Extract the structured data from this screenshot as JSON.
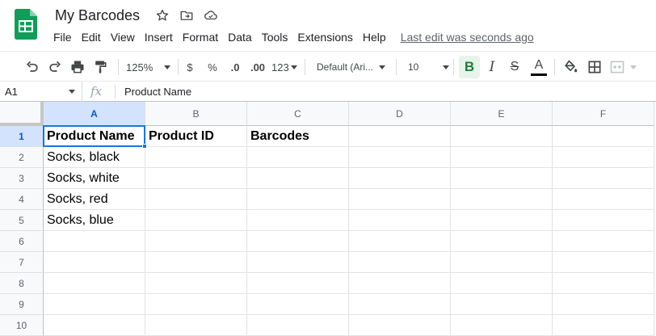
{
  "doc": {
    "title": "My Barcodes",
    "last_edit": "Last edit was seconds ago"
  },
  "menu": [
    "File",
    "Edit",
    "View",
    "Insert",
    "Format",
    "Data",
    "Tools",
    "Extensions",
    "Help"
  ],
  "toolbar": {
    "zoom": "125%",
    "currency": "$",
    "percent": "%",
    "decrease_decimal": ".0",
    "increase_decimal": ".00",
    "more_formats": "123",
    "font": "Default (Ari...",
    "font_size": "10",
    "bold": "B",
    "italic": "I",
    "strikethrough": "S",
    "text_color": "A"
  },
  "formula_bar": {
    "cell_ref": "A1",
    "fx": "fx",
    "value": "Product Name"
  },
  "columns": [
    "A",
    "B",
    "C",
    "D",
    "E",
    "F"
  ],
  "rows": [
    "1",
    "2",
    "3",
    "4",
    "5",
    "6",
    "7",
    "8",
    "9",
    "10"
  ],
  "cells": [
    [
      "Product Name",
      "Product ID",
      "Barcodes",
      "",
      "",
      ""
    ],
    [
      "Socks, black",
      "",
      "",
      "",
      "",
      ""
    ],
    [
      "Socks, white",
      "",
      "",
      "",
      "",
      ""
    ],
    [
      "Socks, red",
      "",
      "",
      "",
      "",
      ""
    ],
    [
      "Socks, blue",
      "",
      "",
      "",
      "",
      ""
    ],
    [
      "",
      "",
      "",
      "",
      "",
      ""
    ],
    [
      "",
      "",
      "",
      "",
      "",
      ""
    ],
    [
      "",
      "",
      "",
      "",
      "",
      ""
    ],
    [
      "",
      "",
      "",
      "",
      "",
      ""
    ],
    [
      "",
      "",
      "",
      "",
      "",
      ""
    ]
  ],
  "colors": {
    "sheets_green": "#0f9d58",
    "selection_blue": "#1a73e8",
    "bold_active_bg": "#e6f4ea"
  }
}
